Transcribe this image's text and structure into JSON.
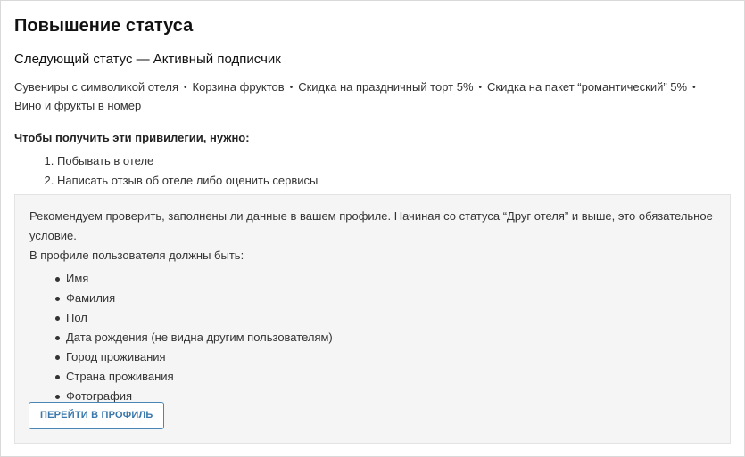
{
  "header": {
    "title": "Повышение статуса",
    "next_status": "Следующий статус — Активный подписчик"
  },
  "perks": {
    "separator": "•",
    "items": [
      "Сувениры с символикой отеля",
      "Корзина фруктов",
      "Скидка на праздничный торт 5%",
      "Скидка на пакет “романтический” 5%",
      "Вино и фрукты в номер"
    ]
  },
  "requirements": {
    "title": "Чтобы получить эти привилегии, нужно:",
    "items": [
      "Побывать в отеле",
      "Написать отзыв об отеле либо оценить сервисы"
    ]
  },
  "profile_note": {
    "text": "Рекомендуем проверить, заполнены ли данные в вашем профиле. Начиная со статуса “Друг отеля” и выше, это обязательное условие.",
    "fields_intro": "В профиле пользователя должны быть:",
    "fields": [
      "Имя",
      "Фамилия",
      "Пол",
      "Дата рождения (не видна другим пользователям)",
      "Город проживания",
      "Страна проживания",
      "Фотография"
    ],
    "button_label": "Перейти в профиль"
  },
  "colors": {
    "accent": "#3a78ab",
    "note_background": "#f5f5f5"
  }
}
